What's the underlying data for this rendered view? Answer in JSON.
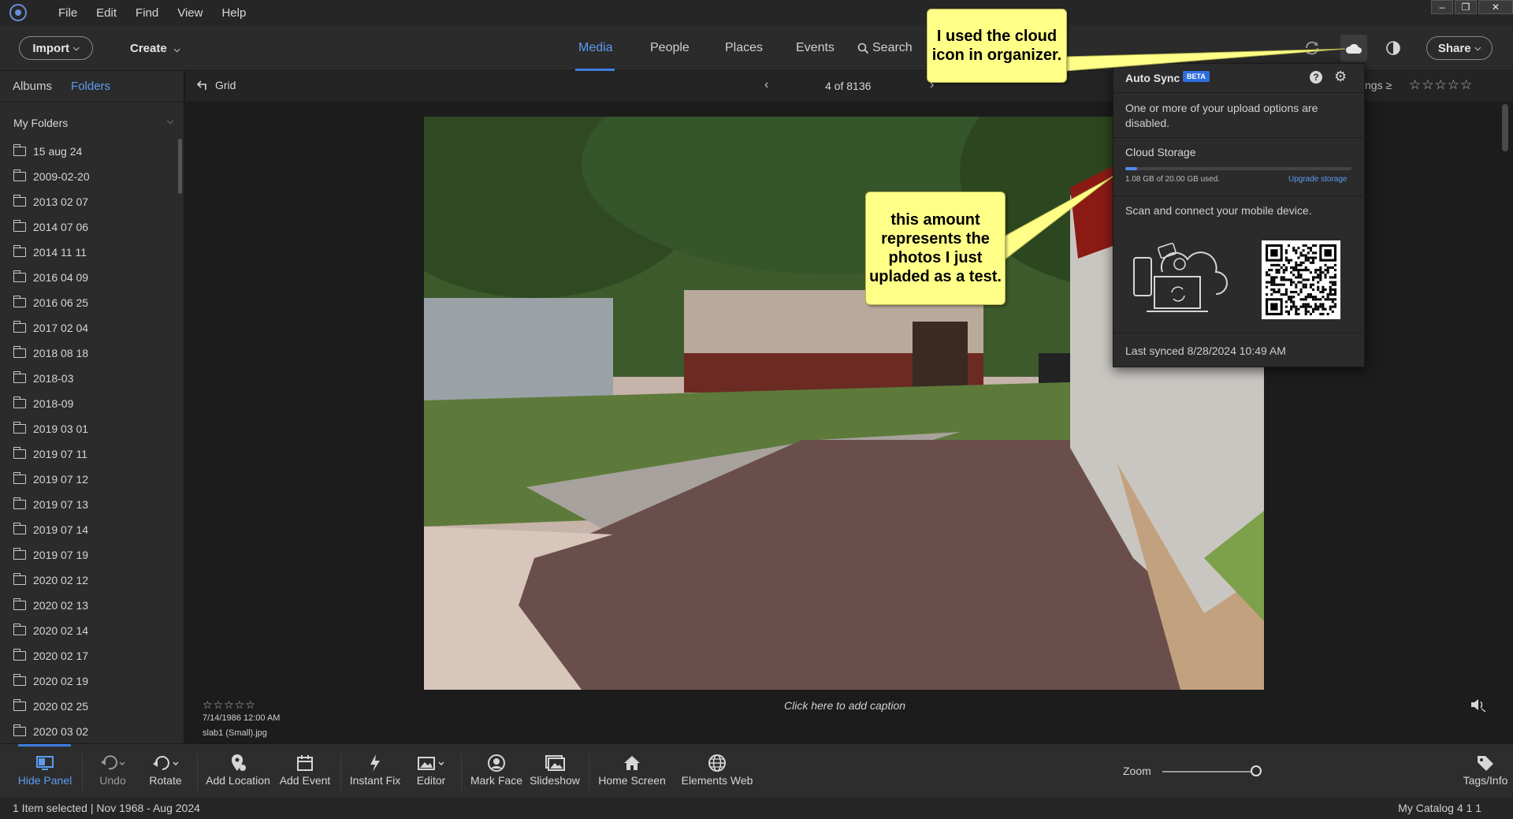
{
  "menu": [
    "File",
    "Edit",
    "Find",
    "View",
    "Help"
  ],
  "window_controls": [
    "–",
    "❐",
    "✕"
  ],
  "toolbar": {
    "import_label": "Import",
    "create_label": "Create",
    "tabs": [
      "Media",
      "People",
      "Places",
      "Events"
    ],
    "active_tab": "Media",
    "search_label": "Search",
    "share_label": "Share"
  },
  "left_panel": {
    "tabs": [
      "Albums",
      "Folders"
    ],
    "active_tab": "Folders",
    "section_title": "My Folders",
    "folders": [
      "15 aug 24",
      "2009-02-20",
      "2013 02 07",
      "2014 07 06",
      "2014 11 11",
      "2016 04 09",
      "2016 06 25",
      "2017 02 04",
      "2018 08 18",
      "2018-03",
      "2018-09",
      "2019 03 01",
      "2019 07 11",
      "2019 07 12",
      "2019 07 13",
      "2019 07 14",
      "2019 07 19",
      "2020 02 12",
      "2020 02 13",
      "2020 02 14",
      "2020 02 17",
      "2020 02 19",
      "2020 02 25",
      "2020 03 02"
    ]
  },
  "content": {
    "back_label": "Grid",
    "pager": "4 of 8136",
    "ratings_label": "tings  ≥",
    "ratings_stars": "☆☆☆☆☆",
    "photo_stars": "☆☆☆☆☆",
    "photo_date": "7/14/1986 12:00 AM",
    "photo_file": "slab1 (Small).jpg",
    "caption_placeholder": "Click here to add caption"
  },
  "popover": {
    "title": "Auto Sync",
    "badge": "BETA",
    "help": "?",
    "warning": "One or more of your upload options are disabled.",
    "storage_title": "Cloud Storage",
    "storage_used_text": "1.08 GB of 20.00 GB used.",
    "storage_used_fraction": 0.054,
    "upgrade_link": "Upgrade storage",
    "scan_text": "Scan and connect your mobile device.",
    "last_synced": "Last synced  8/28/2024 10:49 AM"
  },
  "callouts": {
    "cloud": "I used the cloud icon in organizer.",
    "amount": "this amount represents the photos I just upladed as a test."
  },
  "bottom_toolbar": {
    "items": [
      "Hide Panel",
      "Undo",
      "Rotate",
      "Add Location",
      "Add Event",
      "Instant Fix",
      "Editor",
      "Mark Face",
      "Slideshow",
      "Home Screen",
      "Elements Web"
    ],
    "zoom_label": "Zoom",
    "tags_label": "Tags/Info"
  },
  "status": {
    "left": "1 Item selected | Nov 1968 - Aug 2024",
    "right": "My Catalog 4 1 1"
  },
  "colors": {
    "accent": "#5b9cf0",
    "callout": "#ffff88",
    "background": "#1c1c1c"
  }
}
